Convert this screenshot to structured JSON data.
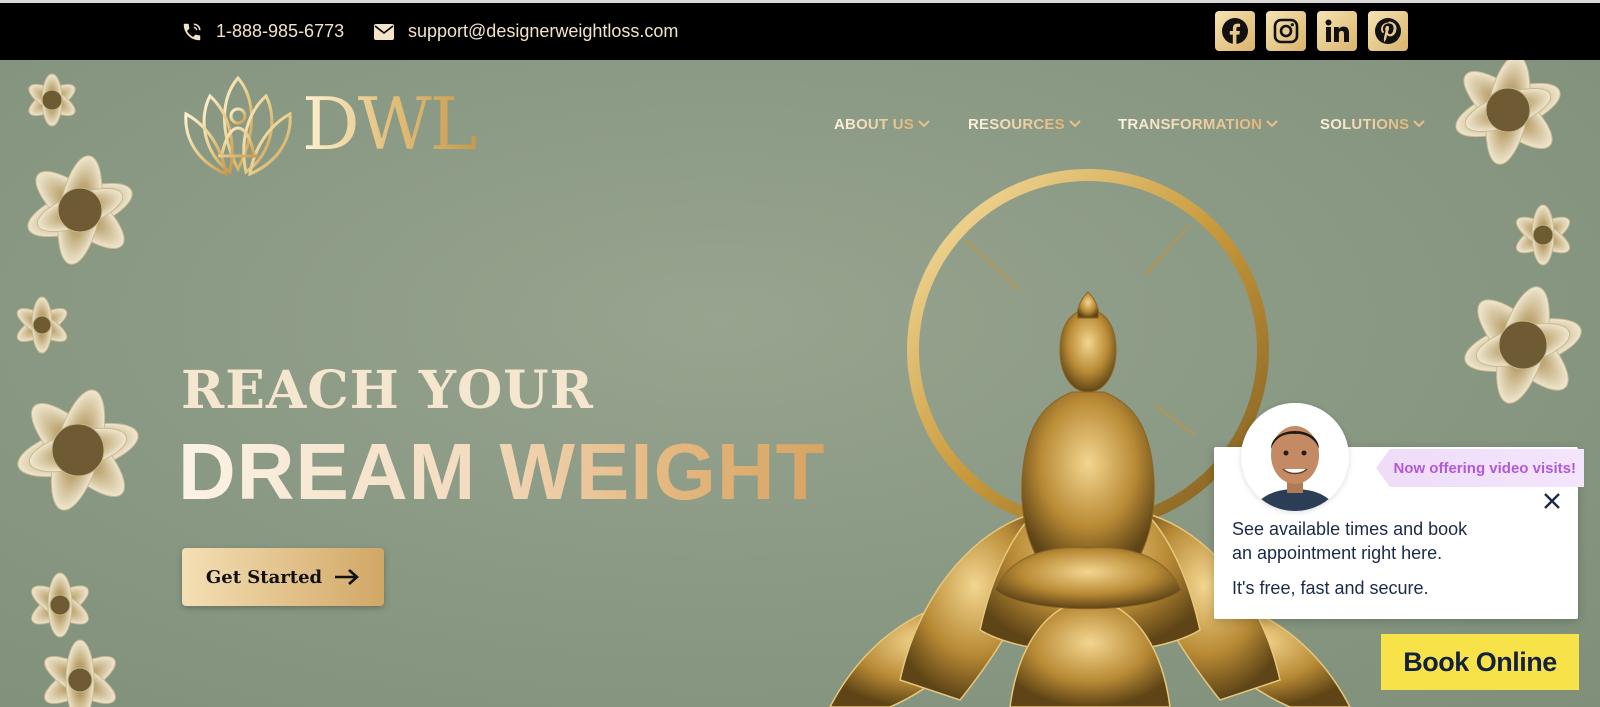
{
  "topbar": {
    "phone": "1-888-985-6773",
    "email": "support@designerweightloss.com",
    "social": [
      {
        "name": "facebook-icon"
      },
      {
        "name": "instagram-icon"
      },
      {
        "name": "linkedin-icon"
      },
      {
        "name": "pinterest-icon"
      }
    ]
  },
  "brand": {
    "logo_text": "DWL"
  },
  "nav": {
    "items": [
      {
        "label": "ABOUT US"
      },
      {
        "label": "RESOURCES"
      },
      {
        "label": "TRANSFORMATION"
      },
      {
        "label": "SOLUTIONS"
      }
    ]
  },
  "hero": {
    "line1": "REACH YOUR",
    "line2": "DREAM WEIGHT",
    "cta_label": "Get Started"
  },
  "booking_widget": {
    "badge": "Now offering video visits!",
    "line1": "See available times and book",
    "line2": "an appointment right here.",
    "line3": "It's free, fast and secure.",
    "button_label": "Book Online"
  },
  "colors": {
    "gold": "#d9b46a",
    "cream": "#f5e6cf",
    "sage": "#8a9a84",
    "book_yellow": "#f7e24a",
    "badge_purple": "#b05ad8"
  }
}
